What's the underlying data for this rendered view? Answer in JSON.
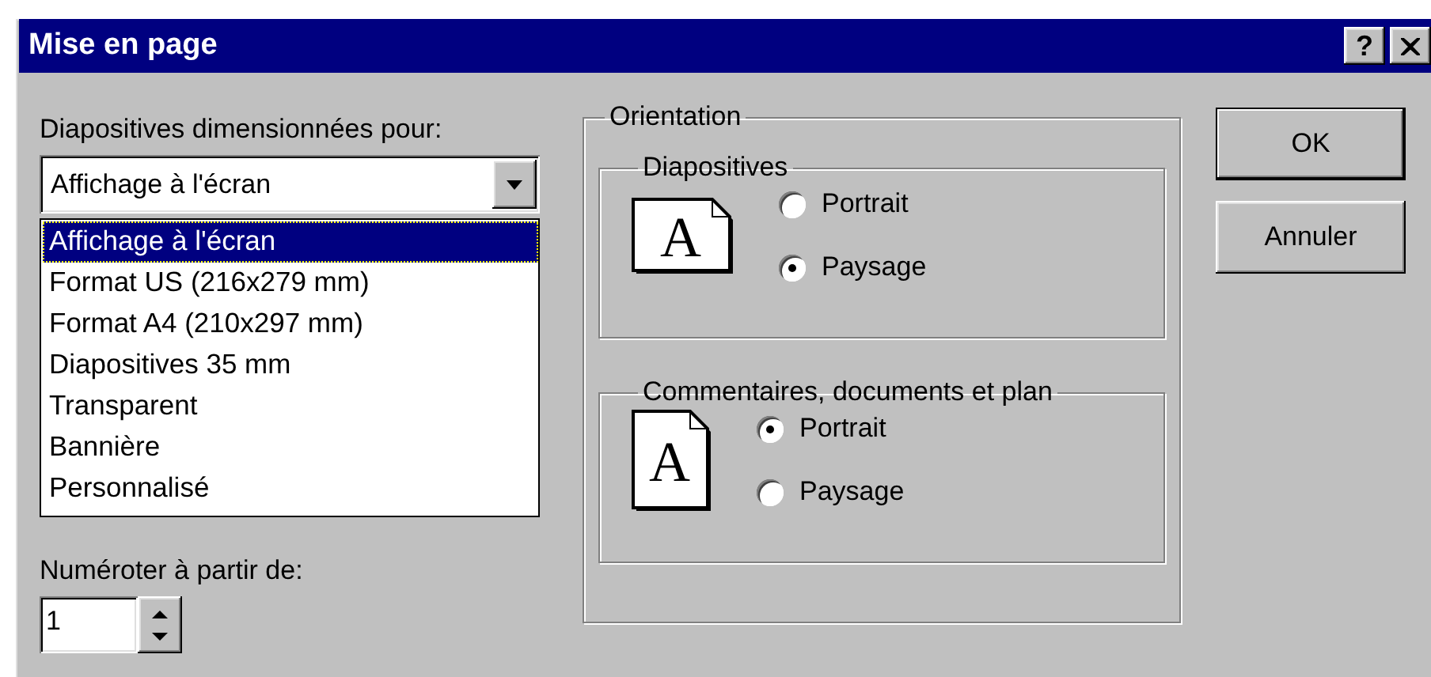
{
  "window": {
    "title": "Mise en page",
    "title_buttons": [
      {
        "kind": "help",
        "symbol": "?"
      },
      {
        "kind": "close"
      }
    ]
  },
  "slide_size": {
    "label": "Diapositives dimensionnées pour:",
    "value": "Affichage à l'écran",
    "expanded": true,
    "options": [
      {
        "label": "Affichage à l'écran",
        "selected": true
      },
      {
        "label": "Format US (216x279 mm)",
        "selected": false
      },
      {
        "label": "Format A4 (210x297 mm)",
        "selected": false
      },
      {
        "label": "Diapositives 35 mm",
        "selected": false
      },
      {
        "label": "Transparent",
        "selected": false
      },
      {
        "label": "Bannière",
        "selected": false
      },
      {
        "label": "Personnalisé",
        "selected": false
      }
    ]
  },
  "numbering": {
    "label": "Numéroter à partir de:",
    "value": "1"
  },
  "orientation": {
    "title": "Orientation",
    "groups": [
      {
        "title": "Diapositives",
        "icon_letter": "A",
        "kind": "landscape",
        "options": [
          {
            "label": "Portrait",
            "selected": false
          },
          {
            "label": "Paysage",
            "selected": true
          }
        ]
      },
      {
        "title": "Commentaires, documents et plan",
        "icon_letter": "A",
        "kind": "portrait",
        "options": [
          {
            "label": "Portrait",
            "selected": true
          },
          {
            "label": "Paysage",
            "selected": false
          }
        ]
      }
    ]
  },
  "buttons": [
    {
      "label": "OK",
      "default": true
    },
    {
      "label": "Annuler",
      "default": false
    }
  ]
}
